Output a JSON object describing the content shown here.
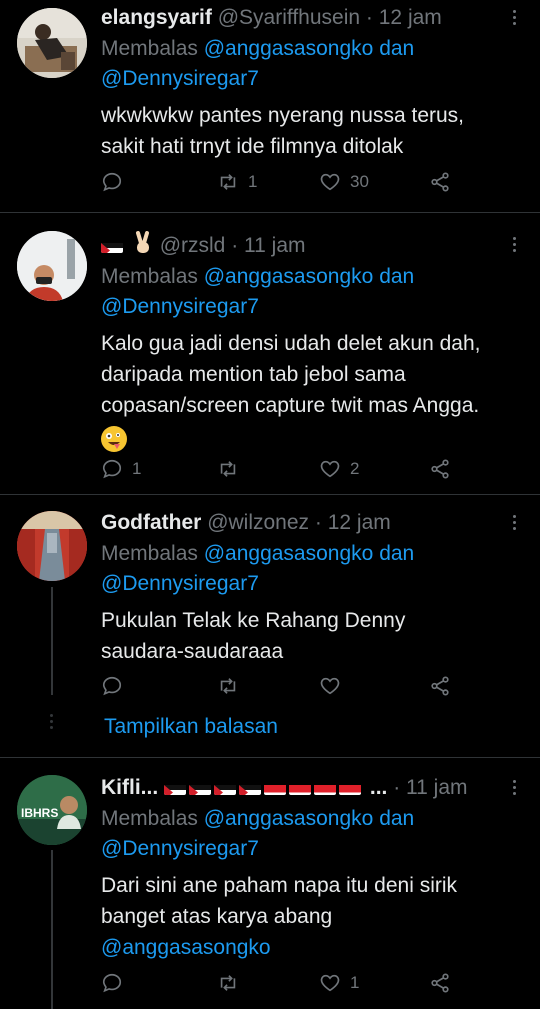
{
  "tweets": [
    {
      "name": "elangsyarif",
      "handle": "@Syariffhusein",
      "time": "· 12 jam",
      "reply_prefix": "Membalas",
      "reply_mention1": "@anggasasongko",
      "reply_joiner": "dan",
      "reply_mention2": "@Dennysiregar7",
      "text_lines": [
        "wkwkwkw pantes nyerang nussa terus,",
        "sakit hati trnyt ide filmnya ditolak"
      ],
      "reply_count": "",
      "retweet_count": "1",
      "like_count": "30"
    },
    {
      "name": "",
      "handle": "@rzsld",
      "time": "· 11 jam",
      "reply_prefix": "Membalas",
      "reply_mention1": "@anggasasongko",
      "reply_joiner": "dan",
      "reply_mention2": "@Dennysiregar7",
      "text_lines": [
        "Kalo gua jadi densi udah delet akun dah,",
        "daripada mention tab jebol sama",
        "copasan/screen capture twit mas Angga."
      ],
      "reply_count": "1",
      "retweet_count": "",
      "like_count": "2"
    },
    {
      "name": "Godfather",
      "handle": "@wilzonez",
      "time": "· 12 jam",
      "reply_prefix": "Membalas",
      "reply_mention1": "@anggasasongko",
      "reply_joiner": "dan",
      "reply_mention2": "@Dennysiregar7",
      "text_lines": [
        "Pukulan Telak ke Rahang Denny",
        "saudara-saudaraaa"
      ],
      "reply_count": "",
      "retweet_count": "",
      "like_count": "",
      "show_replies": "Tampilkan balasan"
    },
    {
      "name": "Kifli...",
      "name_suffix": "...",
      "handle": "",
      "time": "· 11 jam",
      "reply_prefix": "Membalas",
      "reply_mention1": "@anggasasongko",
      "reply_joiner": "dan",
      "reply_mention2": "@Dennysiregar7",
      "text_lines": [
        "Dari sini  ane paham napa itu deni sirik",
        "banget atas karya abang"
      ],
      "text_mention": "@anggasasongko",
      "reply_count": "",
      "retweet_count": "",
      "like_count": "1",
      "avatar_text": "IBHRS"
    }
  ],
  "icons": {
    "reply": "reply-icon",
    "retweet": "retweet-icon",
    "like": "heart-icon",
    "share": "share-icon",
    "menu": "more-vertical-icon"
  },
  "colors": {
    "background": "#000000",
    "text": "#e7e9ea",
    "muted": "#71767b",
    "link": "#1d9bf0",
    "divider": "#2f3336"
  }
}
